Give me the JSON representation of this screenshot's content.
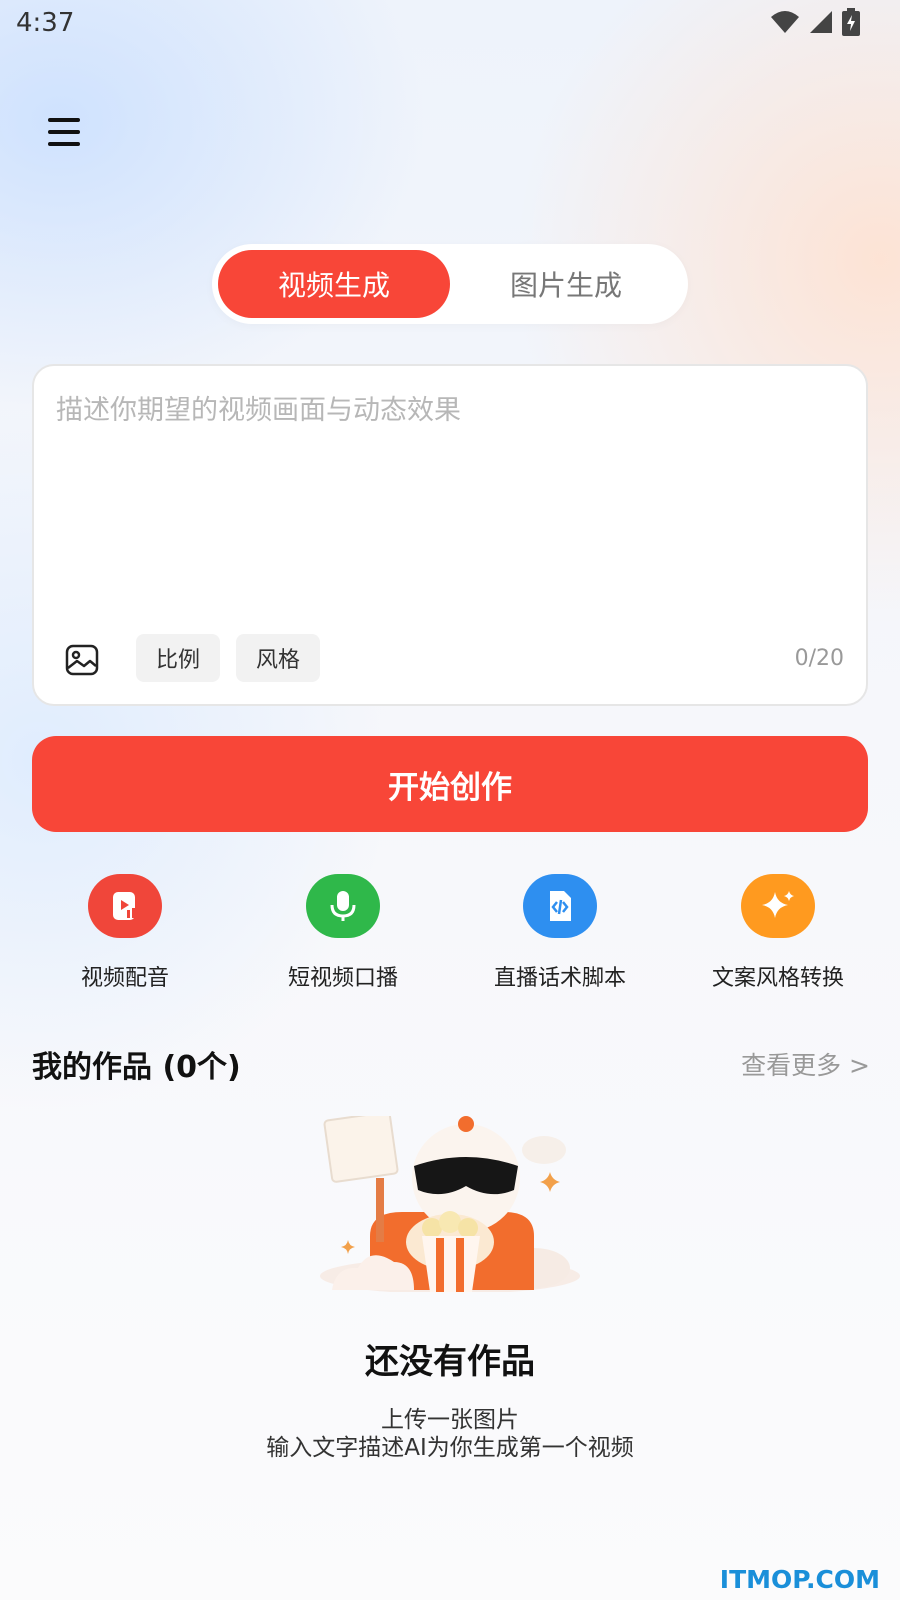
{
  "status_bar": {
    "time": "4:37",
    "icons": [
      "wifi-icon",
      "cellular-signal-icon",
      "battery-charging-icon"
    ]
  },
  "header": {
    "menu_icon": "hamburger-menu-icon"
  },
  "mode_switch": {
    "tabs": [
      {
        "label": "视频生成",
        "active": true
      },
      {
        "label": "图片生成",
        "active": false
      }
    ],
    "active_color": "#f84638"
  },
  "prompt": {
    "value": "",
    "placeholder": "描述你期望的视频画面与动态效果",
    "image_upload_icon": "image-icon",
    "chips": [
      "比例",
      "风格"
    ],
    "char_count": "0/20"
  },
  "start_button": {
    "label": "开始创作",
    "color": "#f84638"
  },
  "tools": [
    {
      "label": "视频配音",
      "icon": "video-dubbing-icon",
      "color": "#f0463a"
    },
    {
      "label": "短视频口播",
      "icon": "microphone-icon",
      "color": "#2fb84a"
    },
    {
      "label": "直播话术脚本",
      "icon": "code-file-icon",
      "color": "#2e8ff0"
    },
    {
      "label": "文案风格转换",
      "icon": "sparkle-icon",
      "color": "#ff9a1f"
    }
  ],
  "works": {
    "title": "我的作品 (0个)",
    "view_more": "查看更多 >",
    "illustration": "robot-with-popcorn-illustration",
    "empty_title": "还没有作品",
    "empty_line_1": "上传一张图片",
    "empty_line_2": "输入文字描述AI为你生成第一个视频"
  },
  "watermark": "ITMOP.COM"
}
